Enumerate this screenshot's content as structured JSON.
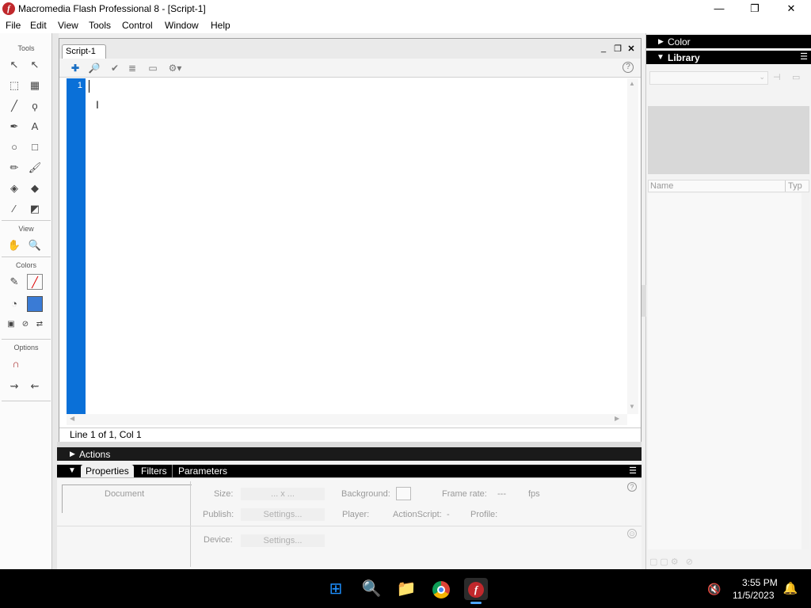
{
  "window": {
    "title": "Macromedia Flash Professional 8 - [Script-1]",
    "logo_glyph": "f"
  },
  "window_controls": {
    "minimize": "—",
    "maximize": "❐",
    "close": "✕"
  },
  "menu": [
    "File",
    "Edit",
    "View",
    "Tools",
    "Control",
    "Window",
    "Help"
  ],
  "tools": {
    "section_tools": "Tools",
    "section_view": "View",
    "section_colors": "Colors",
    "section_options": "Options"
  },
  "script": {
    "tab_label": "Script-1",
    "line_number": "1",
    "status": "Line 1 of 1, Col 1",
    "toolbar_icons": [
      "add-icon",
      "find-icon",
      "check-syntax-icon",
      "auto-format-icon",
      "code-hint-icon",
      "debug-options-icon",
      "help-icon"
    ]
  },
  "panels": {
    "actions_label": "Actions",
    "properties_tabs": [
      "Properties",
      "Filters",
      "Parameters"
    ],
    "color_label": "Color",
    "library_label": "Library",
    "library_name_col": "Name",
    "library_type_col": "Typ"
  },
  "properties": {
    "document_label": "Document",
    "size_label": "Size:",
    "size_value": "... x ...",
    "background_label": "Background:",
    "frame_rate_label": "Frame rate:",
    "frame_rate_value": "---",
    "fps_label": "fps",
    "publish_label": "Publish:",
    "publish_settings": "Settings...",
    "player_label": "Player:",
    "actionscript_label": "ActionScript:",
    "actionscript_value": "-",
    "profile_label": "Profile:",
    "device_label": "Device:",
    "device_settings": "Settings..."
  },
  "taskbar": {
    "time": "3:55 PM",
    "date": "11/5/2023"
  },
  "colors": {
    "gutter": "#0a70d8",
    "flash_red": "#c0282c",
    "taskbar": "#000000"
  }
}
